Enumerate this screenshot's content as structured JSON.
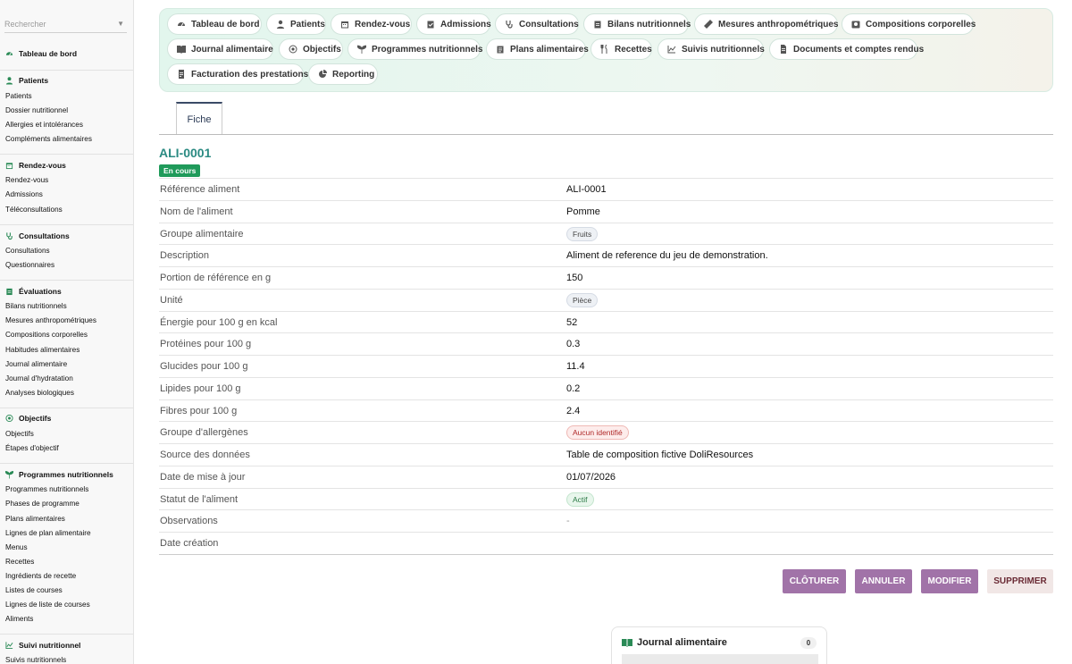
{
  "sidebar": {
    "search_placeholder": "Rechercher",
    "sections": [
      {
        "title": "Tableau de bord",
        "icon": "dashboard-icon",
        "items": []
      },
      {
        "title": "Patients",
        "icon": "user-icon",
        "items": [
          "Patients",
          "Dossier nutritionnel",
          "Allergies et intolérances",
          "Compléments alimentaires"
        ]
      },
      {
        "title": "Rendez-vous",
        "icon": "calendar-icon",
        "items": [
          "Rendez-vous",
          "Admissions",
          "Téléconsultations"
        ]
      },
      {
        "title": "Consultations",
        "icon": "stethoscope-icon",
        "items": [
          "Consultations",
          "Questionnaires"
        ]
      },
      {
        "title": "Évaluations",
        "icon": "clipboard-icon",
        "items": [
          "Bilans nutritionnels",
          "Mesures anthropométriques",
          "Compositions corporelles",
          "Habitudes alimentaires",
          "Journal alimentaire",
          "Journal d'hydratation",
          "Analyses biologiques"
        ]
      },
      {
        "title": "Objectifs",
        "icon": "target-icon",
        "items": [
          "Objectifs",
          "Étapes d'objectif"
        ]
      },
      {
        "title": "Programmes nutritionnels",
        "icon": "sprout-icon",
        "items": [
          "Programmes nutritionnels",
          "Phases de programme",
          "Plans alimentaires",
          "Lignes de plan alimentaire",
          "Menus",
          "Recettes",
          "Ingrédients de recette",
          "Listes de courses",
          "Lignes de liste de courses",
          "Aliments"
        ]
      },
      {
        "title": "Suivi nutritionnel",
        "icon": "chart-line-icon",
        "items": [
          "Suivis nutritionnels"
        ]
      }
    ]
  },
  "topnav": [
    {
      "label": "Tableau de bord",
      "icon": "dashboard-icon"
    },
    {
      "label": "Patients",
      "icon": "user-icon"
    },
    {
      "label": "Rendez-vous",
      "icon": "calendar-icon"
    },
    {
      "label": "Admissions",
      "icon": "clipboard-check-icon"
    },
    {
      "label": "Consultations",
      "icon": "stethoscope-icon"
    },
    {
      "label": "Bilans nutritionnels",
      "icon": "clipboard-icon"
    },
    {
      "label": "Mesures anthropométriques",
      "icon": "ruler-icon"
    },
    {
      "label": "Compositions corporelles",
      "icon": "scale-icon"
    },
    {
      "label": "Journal alimentaire",
      "icon": "book-icon"
    },
    {
      "label": "Objectifs",
      "icon": "target-icon"
    },
    {
      "label": "Programmes nutritionnels",
      "icon": "sprout-icon"
    },
    {
      "label": "Plans alimentaires",
      "icon": "clipboard-list-icon"
    },
    {
      "label": "Recettes",
      "icon": "utensils-icon"
    },
    {
      "label": "Suivis nutritionnels",
      "icon": "chart-line-icon"
    },
    {
      "label": "Documents et comptes rendus",
      "icon": "document-icon"
    },
    {
      "label": "Facturation des prestations",
      "icon": "invoice-icon"
    },
    {
      "label": "Reporting",
      "icon": "pie-chart-icon"
    }
  ],
  "tabs": [
    {
      "label": "Fiche",
      "active": true
    }
  ],
  "record": {
    "ref": "ALI-0001",
    "status": "En cours",
    "status_color": "#1f9a5a"
  },
  "fields": [
    {
      "label": "Référence aliment",
      "value": "ALI-0001",
      "kind": "text"
    },
    {
      "label": "Nom de l'aliment",
      "value": "Pomme",
      "kind": "text"
    },
    {
      "label": "Groupe alimentaire",
      "value": "Fruits",
      "kind": "badge-gray"
    },
    {
      "label": "Description",
      "value": "Aliment de reference du jeu de demonstration.",
      "kind": "text"
    },
    {
      "label": "Portion de référence en g",
      "value": "150",
      "kind": "text"
    },
    {
      "label": "Unité",
      "value": "Pièce",
      "kind": "badge-gray"
    },
    {
      "label": "Énergie pour 100 g en kcal",
      "value": "52",
      "kind": "text"
    },
    {
      "label": "Protéines pour 100 g",
      "value": "0.3",
      "kind": "text"
    },
    {
      "label": "Glucides pour 100 g",
      "value": "11.4",
      "kind": "text"
    },
    {
      "label": "Lipides pour 100 g",
      "value": "0.2",
      "kind": "text"
    },
    {
      "label": "Fibres pour 100 g",
      "value": "2.4",
      "kind": "text"
    },
    {
      "label": "Groupe d'allergènes",
      "value": "Aucun identifié",
      "kind": "badge-red"
    },
    {
      "label": "Source des données",
      "value": "Table de composition fictive DoliResources",
      "kind": "text"
    },
    {
      "label": "Date de mise à jour",
      "value": "01/07/2026",
      "kind": "text"
    },
    {
      "label": "Statut de l'aliment",
      "value": "Actif",
      "kind": "badge-green"
    },
    {
      "label": "Observations",
      "value": "-",
      "kind": "dash"
    },
    {
      "label": "Date création",
      "value": "",
      "kind": "text"
    }
  ],
  "actions": {
    "close_label": "CLÔTURER",
    "cancel_label": "ANNULER",
    "edit_label": "MODIFIER",
    "delete_label": "SUPPRIMER"
  },
  "related_card": {
    "title": "Journal alimentaire",
    "count": "0"
  }
}
